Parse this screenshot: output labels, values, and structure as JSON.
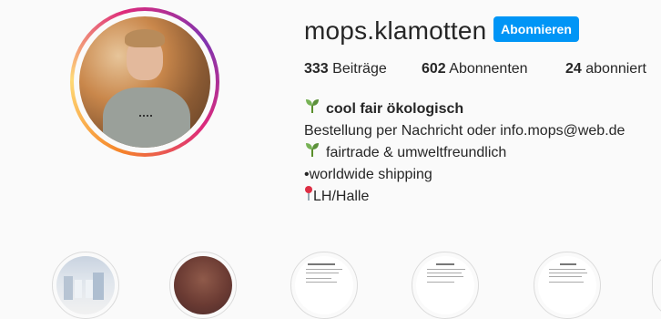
{
  "profile": {
    "username": "mops.klamotten",
    "follow_label": "Abonnieren"
  },
  "stats": {
    "posts": {
      "count": "333",
      "label": "Beiträge"
    },
    "followers": {
      "count": "602",
      "label": "Abonnenten"
    },
    "following": {
      "count": "24",
      "label": "abonniert"
    }
  },
  "bio": {
    "name": "cool fair ökologisch",
    "line1": "Bestellung per Nachricht oder info.mops@web.de",
    "line2": "fairtrade & umweltfreundlich",
    "line3": "•worldwide shipping",
    "line4": "LH/Halle"
  },
  "icons": {
    "name_emoji": "seedling-icon",
    "line2_emoji": "seedling-icon",
    "line4_emoji": "pushpin-icon"
  },
  "colors": {
    "follow_button": "#0095f6",
    "text": "#262626",
    "background": "#fafafa"
  }
}
